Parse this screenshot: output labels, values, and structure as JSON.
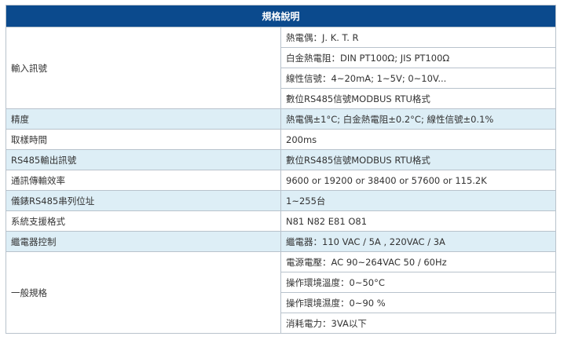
{
  "table": {
    "header": "規格說明",
    "groups": [
      {
        "label": "輸入訊號",
        "shaded": false,
        "values": [
          "熱電偶：J. K. T. R",
          "白金熱電阻：DIN PT100Ω; JIS PT100Ω",
          "線性信號：4~20mA; 1~5V; 0~10V...",
          "數位RS485信號MODBUS RTU格式"
        ]
      },
      {
        "label": "精度",
        "shaded": true,
        "values": [
          "熱電偶±1°C; 白金熱電阻±0.2°C; 線性信號±0.1%"
        ]
      },
      {
        "label": "取樣時間",
        "shaded": false,
        "values": [
          "200ms"
        ]
      },
      {
        "label": "RS485輸出訊號",
        "shaded": true,
        "values": [
          "數位RS485信號MODBUS RTU格式"
        ]
      },
      {
        "label": "通訊傳輸效率",
        "shaded": false,
        "values": [
          "9600 or 19200 or 38400 or 57600 or 115.2K"
        ]
      },
      {
        "label": "儀錶RS485串列位址",
        "shaded": true,
        "values": [
          "1~255台"
        ]
      },
      {
        "label": "系統支援格式",
        "shaded": false,
        "values": [
          "N81 N82 E81 O81"
        ]
      },
      {
        "label": "繼電器控制",
        "shaded": true,
        "values": [
          "繼電器：110 VAC / 5A , 220VAC / 3A"
        ]
      },
      {
        "label": "一般規格",
        "shaded": false,
        "values": [
          "電源電壓：AC 90~264VAC 50 / 60Hz",
          "操作環境溫度：0~50°C",
          "操作環境濕度：0~90 %",
          "消耗電力：3VA以下"
        ]
      }
    ]
  }
}
